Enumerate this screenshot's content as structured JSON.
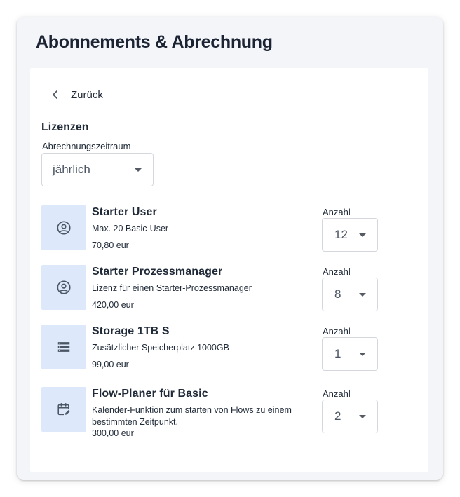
{
  "page": {
    "title": "Abonnements & Abrechnung"
  },
  "nav": {
    "back_label": "Zurück"
  },
  "licenses": {
    "section_title": "Lizenzen",
    "period_label": "Abrechnungszeitraum",
    "period_value": "jährlich",
    "quantity_label": "Anzahl",
    "items": [
      {
        "icon": "account-circle-icon",
        "name": "Starter User",
        "description": "Max. 20 Basic-User",
        "price": "70,80 eur",
        "quantity": "12"
      },
      {
        "icon": "account-circle-icon",
        "name": "Starter Prozessmanager",
        "description": "Lizenz für einen Starter-Prozessmanager",
        "price": "420,00 eur",
        "quantity": "8"
      },
      {
        "icon": "storage-icon",
        "name": "Storage 1TB S",
        "description": "Zusätzlicher Speicherplatz 1000GB",
        "price": "99,00 eur",
        "quantity": "1"
      },
      {
        "icon": "calendar-edit-icon",
        "name": "Flow-Planer für Basic",
        "description": "Kalender-Funktion zum starten von Flows zu einem bestimmten Zeitpunkt.",
        "price": "300,00 eur",
        "quantity": "2"
      }
    ]
  },
  "colors": {
    "card_background": "#f3f5f9",
    "icon_tile": "#dde9fb",
    "icon_stroke": "#4b5563",
    "text": "#1f2937"
  }
}
